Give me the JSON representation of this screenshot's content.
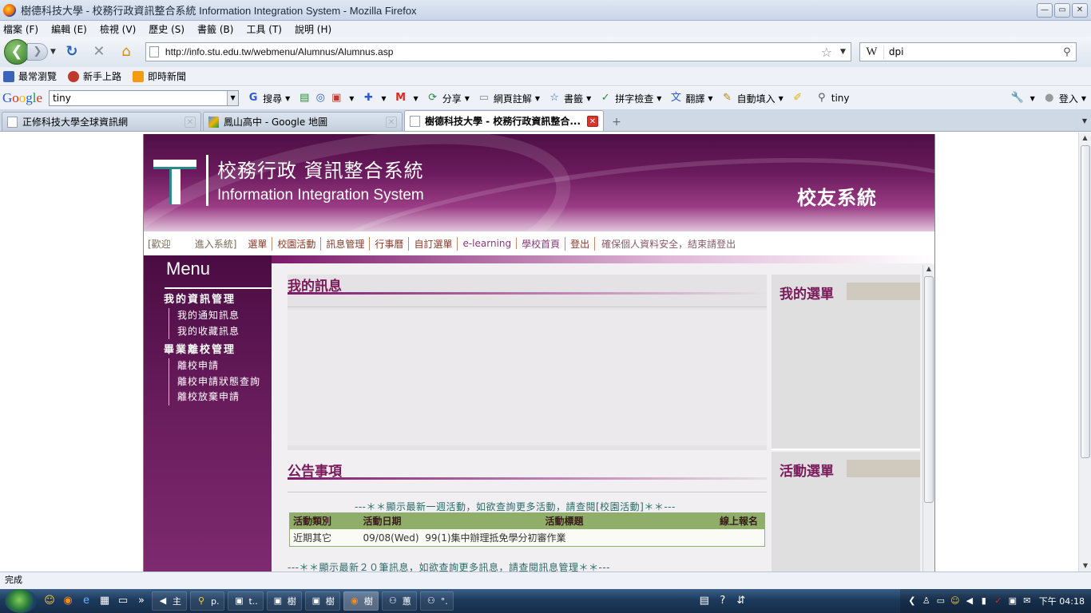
{
  "window": {
    "title": "樹德科技大學 - 校務行政資訊整合系統 Information Integration System - Mozilla Firefox",
    "buttons": {
      "minimize": "—",
      "maximize": "▭",
      "close": "✕"
    }
  },
  "menubar": [
    "檔案 (F)",
    "編輯 (E)",
    "檢視 (V)",
    "歷史 (S)",
    "書籤 (B)",
    "工具 (T)",
    "說明 (H)"
  ],
  "navbar": {
    "url": "http://info.stu.edu.tw/webmenu/Alumnus/Alumnus.asp",
    "search_engine": "W",
    "search_value": "dpi"
  },
  "bookmarks": [
    {
      "label": "最常瀏覽",
      "icon": "bookmark-folder-icon",
      "color": "#3a64b8"
    },
    {
      "label": "新手上路",
      "icon": "firefox-icon",
      "color": "#c0392b"
    },
    {
      "label": "即時新聞",
      "icon": "rss-feed-icon",
      "color": "#f39c12"
    }
  ],
  "googlebar": {
    "logo": [
      "G",
      "o",
      "o",
      "g",
      "l",
      "e"
    ],
    "query": "tiny",
    "tools": [
      {
        "label": "搜尋",
        "icon": "google-search-icon"
      },
      {
        "label": "",
        "icon": "page-rank-icon"
      },
      {
        "label": "",
        "icon": "gmail-icon"
      },
      {
        "label": "分享",
        "icon": "share-icon"
      },
      {
        "label": "網頁註解",
        "icon": "comment-icon"
      },
      {
        "label": "書籤",
        "icon": "star-bookmark-icon"
      },
      {
        "label": "拼字檢查",
        "icon": "spellcheck-icon"
      },
      {
        "label": "翻譯",
        "icon": "translate-icon"
      },
      {
        "label": "自動填入",
        "icon": "autofill-icon"
      },
      {
        "label": "tiny",
        "icon": "magnifier-icon"
      }
    ],
    "login_label": "登入"
  },
  "tabs": [
    {
      "label": "正修科技大學全球資訊網",
      "active": false
    },
    {
      "label": "鳳山高中 - Google 地圖",
      "active": false
    },
    {
      "label": "樹德科技大學 - 校務行政資訊整合...",
      "active": true
    }
  ],
  "site": {
    "banner": {
      "title_zh": "校務行政 資訊整合系統",
      "title_en": "Information Integration System",
      "system_name": "校友系統"
    },
    "topnav": {
      "welcome_prefix": "[歡迎",
      "welcome_suffix": "進入系統]",
      "links": [
        "選單",
        "校園活動",
        "訊息管理",
        "行事曆",
        "自訂選單",
        "e-learning",
        "學校首頁",
        "登出"
      ],
      "notice": "確保個人資料安全，結束請登出"
    },
    "sidebar": {
      "menu_title": "Menu",
      "groups": [
        {
          "title": "我的資訊管理",
          "items": [
            "我的通知訊息",
            "我的收藏訊息"
          ]
        },
        {
          "title": "畢業離校管理",
          "items": [
            "離校申請",
            "離校申請狀態查詢",
            "離校放棄申請"
          ]
        }
      ]
    },
    "my_messages": {
      "title": "我的訊息"
    },
    "my_menu": {
      "title": "我的選單"
    },
    "activity_menu": {
      "title": "活動選單"
    },
    "announcements": {
      "title": "公告事項",
      "note_top": "---＊＊顯示最新一週活動，如欲查詢更多活動，請查閱[校園活動]＊＊---",
      "columns": [
        "活動類別",
        "活動日期",
        "活動標題",
        "線上報名"
      ],
      "rows": [
        {
          "category": "近期其它",
          "date": "09/08(Wed)",
          "title": "99(1)集中辦理抵免學分初審作業",
          "signup": ""
        }
      ],
      "note_bottom": "---＊＊顯示最新２０筆訊息，如欲查詢更多訊息，請查閱訊息管理＊＊---"
    }
  },
  "status": {
    "text": "完成"
  },
  "taskbar": {
    "tasks": [
      {
        "label": "主",
        "icon": "speaker-icon"
      },
      {
        "label": "p.",
        "icon": "search-app-icon"
      },
      {
        "label": "t..",
        "icon": "window-icon"
      },
      {
        "label": "樹",
        "icon": "window-icon"
      },
      {
        "label": "樹",
        "icon": "window-icon"
      },
      {
        "label": "樹",
        "icon": "firefox-icon"
      },
      {
        "label": "蕙",
        "icon": "network-icon"
      },
      {
        "label": "°.",
        "icon": "network-icon"
      }
    ],
    "clock": "下午 04:18"
  }
}
